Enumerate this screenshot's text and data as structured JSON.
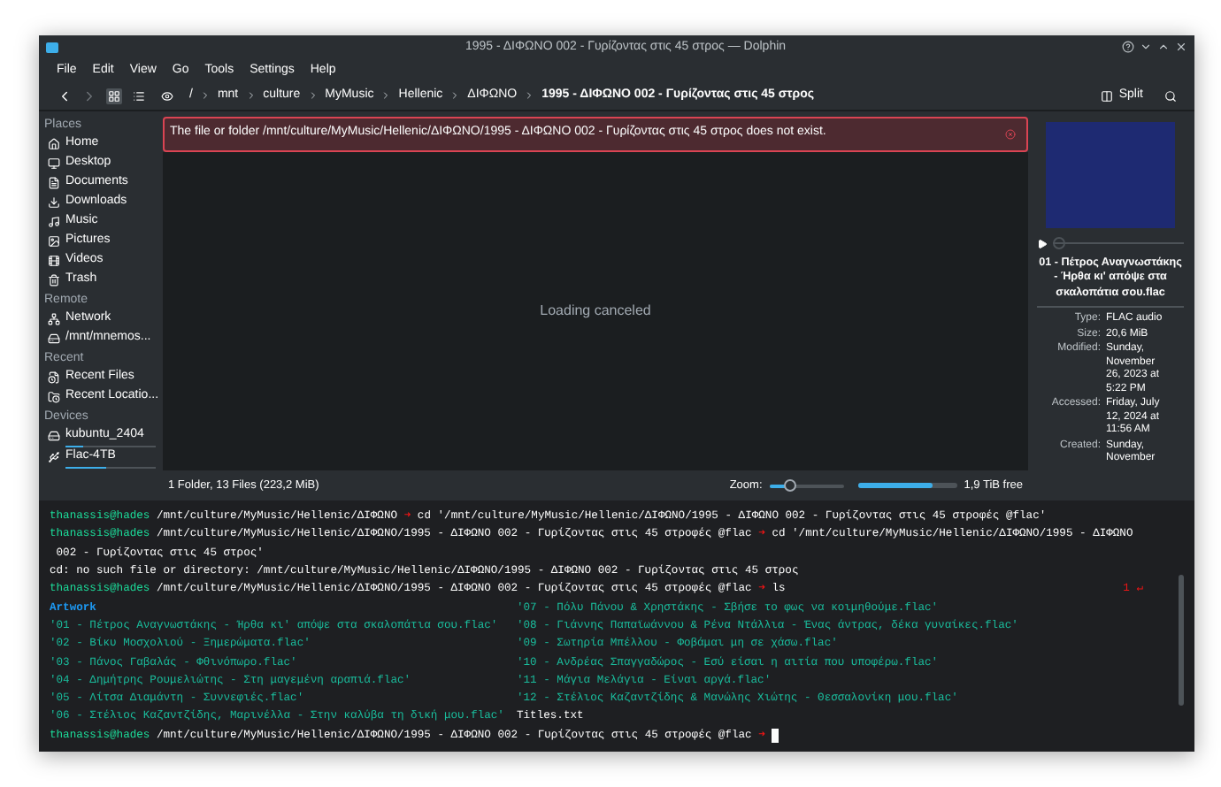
{
  "window": {
    "title": "1995 - ΔΙΦΩΝΟ 002 - Γυρίζοντας στις 45 στρος — Dolphin"
  },
  "menu": [
    "File",
    "Edit",
    "View",
    "Go",
    "Tools",
    "Settings",
    "Help"
  ],
  "toolbar": {
    "view_modes": [
      {
        "selected": true
      },
      {
        "selected": false
      }
    ],
    "breadcrumb": [
      "/",
      "mnt",
      "culture",
      "MyMusic",
      "Hellenic",
      "ΔΙΦΩΝΟ",
      "1995 - ΔΙΦΩΝΟ 002 - Γυρίζοντας στις 45 στρος"
    ],
    "split_label": "Split"
  },
  "sidebar": [
    {
      "heading": "Places",
      "items": [
        {
          "label": "Home",
          "selected": false
        },
        {
          "label": "Desktop",
          "selected": false
        },
        {
          "label": "Documents",
          "selected": false
        },
        {
          "label": "Downloads",
          "selected": false
        },
        {
          "label": "Music",
          "selected": false
        },
        {
          "label": "Pictures",
          "selected": false
        },
        {
          "label": "Videos",
          "selected": false
        },
        {
          "label": "Trash",
          "selected": false
        }
      ]
    },
    {
      "heading": "Remote",
      "items": [
        {
          "label": "Network",
          "selected": false
        },
        {
          "label": "/mnt/mnemos...",
          "selected": false
        }
      ]
    },
    {
      "heading": "Recent",
      "items": [
        {
          "label": "Recent Files",
          "selected": false
        },
        {
          "label": "Recent Locatio...",
          "selected": false
        }
      ]
    },
    {
      "heading": "Devices",
      "items": [
        {
          "label": "kubuntu_2404",
          "selected": false,
          "level": 0.2
        },
        {
          "label": "Flac-4TB",
          "selected": false,
          "level": 0.45
        }
      ]
    }
  ],
  "error_banner": "The file or folder /mnt/culture/MyMusic/Hellenic/ΔΙΦΩΝΟ/1995 - ΔΙΦΩΝΟ 002 - Γυρίζοντας στις 45 στρος does not exist.",
  "view_message": "Loading canceled",
  "status_bar": {
    "summary": "1 Folder, 13 Files (223,2 MiB)",
    "zoom_label": "Zoom:",
    "zoom": {
      "level": 0.27
    },
    "space": {
      "level": 0.75
    },
    "free_label": "1,9 TiB free"
  },
  "info_panel": {
    "seek": {
      "level": 0
    },
    "title": "01 - Πέτρος Αναγνωστάκης - Ήρθα κι' απόψε στα σκαλοπάτια σου.flac",
    "details": [
      {
        "label": "Type:",
        "value": "FLAC audio"
      },
      {
        "label": "Size:",
        "value": "20,6 MiB"
      },
      {
        "label": "Modified:",
        "value": "Sunday, November 26, 2023 at 5:22 PM"
      },
      {
        "label": "Accessed:",
        "value": "Friday, July 12, 2024 at 11:56 AM"
      },
      {
        "label": "Created:",
        "value": "Sunday, November"
      }
    ]
  },
  "terminal": {
    "lines": [
      {
        "kind": "prompt",
        "user": "thanassis@hades",
        "path": "/mnt/culture/MyMusic/Hellenic/ΔΙΦΩΝΟ",
        "arrow": "➜",
        "command": "cd '/mnt/culture/MyMusic/Hellenic/ΔΙΦΩΝΟ/1995 - ΔΙΦΩΝΟ 002 - Γυρίζοντας στις 45 στροφές @flac'"
      },
      {
        "kind": "prompt",
        "user": "thanassis@hades",
        "path": "/mnt/culture/MyMusic/Hellenic/ΔΙΦΩΝΟ/1995 - ΔΙΦΩΝΟ 002 - Γυρίζοντας στις 45 στροφές @flac",
        "arrow": "➜",
        "command": "cd '/mnt/culture/MyMusic/Hellenic/ΔΙΦΩΝΟ/1995 - ΔΙΦΩΝΟ"
      },
      {
        "kind": "output",
        "text": " 002 - Γυρίζοντας στις 45 στρος'"
      },
      {
        "kind": "output",
        "text": "cd: no such file or directory: /mnt/culture/MyMusic/Hellenic/ΔΙΦΩΝΟ/1995 - ΔΙΦΩΝΟ 002 - Γυρίζοντας στις 45 στρος"
      },
      {
        "kind": "prompt",
        "user": "thanassis@hades",
        "path": "/mnt/culture/MyMusic/Hellenic/ΔΙΦΩΝΟ/1995 - ΔΙΦΩΝΟ 002 - Γυρίζοντας στις 45 στροφές @flac",
        "arrow": "➜",
        "command": "ls",
        "status": "1 ↵"
      }
    ],
    "listing": [
      [
        {
          "name": "Artwork",
          "kind": "dir"
        },
        {
          "name": "'01 - Πέτρος Αναγνωστάκης - Ήρθα κι' απόψε στα σκαλοπάτια σου.flac'",
          "kind": "audio"
        },
        {
          "name": "'02 - Βίκυ Μοσχολιού - Ξημερώματα.flac'",
          "kind": "audio"
        },
        {
          "name": "'03 - Πάνος Γαβαλάς - Φθινόπωρο.flac'",
          "kind": "audio"
        },
        {
          "name": "'04 - Δημήτρης Ρουμελιώτης - Στη μαγεμένη αραπιά.flac'",
          "kind": "audio"
        },
        {
          "name": "'05 - Λίτσα Διαμάντη - Συννεφιές.flac'",
          "kind": "audio"
        },
        {
          "name": "'06 - Στέλιος Καζαντζίδης, Μαρινέλλα - Στην καλύβα τη δική μου.flac'",
          "kind": "audio"
        }
      ],
      [
        {
          "name": "'07 - Πόλυ Πάνου & Χρηστάκης - Σβήσε το φως να κοιμηθούμε.flac'",
          "kind": "audio"
        },
        {
          "name": "'08 - Γιάννης Παπαϊωάννου & Ρένα Ντάλλια - Ένας άντρας, δέκα γυναίκες.flac'",
          "kind": "audio"
        },
        {
          "name": "'09 - Σωτηρία Μπέλλου - Φοβάμαι μη σε χάσω.flac'",
          "kind": "audio"
        },
        {
          "name": "'10 - Ανδρέας Σπαγγαδώρος - Εσύ είσαι η αιτία που υποφέρω.flac'",
          "kind": "audio"
        },
        {
          "name": "'11 - Μάγια Μελάγια - Είναι αργά.flac'",
          "kind": "audio"
        },
        {
          "name": "'12 - Στέλιος Καζαντζίδης & Μανώλης Χιώτης - Θεσσαλονίκη μου.flac'",
          "kind": "audio"
        },
        {
          "name": "Titles.txt",
          "kind": "text"
        }
      ]
    ],
    "final_prompt": {
      "user": "thanassis@hades",
      "path": "/mnt/culture/MyMusic/Hellenic/ΔΙΦΩΝΟ/1995 - ΔΙΦΩΝΟ 002 - Γυρίζοντας στις 45 στροφές @flac",
      "arrow": "➜"
    }
  }
}
